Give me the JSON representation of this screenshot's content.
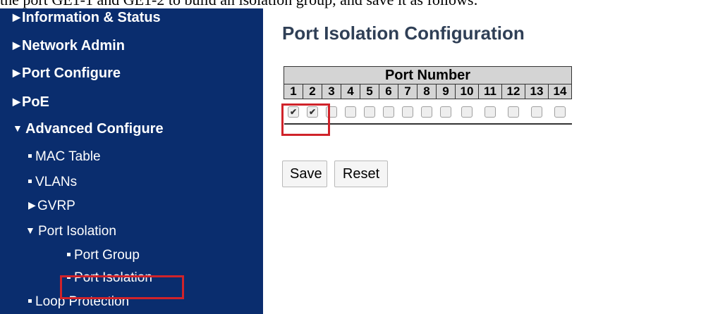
{
  "document": {
    "text_line": "the port GE1-1 and GE1-2 to build an isolation group, and save it as follows:"
  },
  "sidebar": {
    "items": [
      {
        "label": "Information & Status",
        "level": 0,
        "expanded": false
      },
      {
        "label": "Network Admin",
        "level": 0,
        "expanded": false
      },
      {
        "label": "Port Configure",
        "level": 0,
        "expanded": false
      },
      {
        "label": "PoE",
        "level": 0,
        "expanded": false
      },
      {
        "label": "Advanced Configure",
        "level": 0,
        "expanded": true
      },
      {
        "label": "MAC Table",
        "level": 1
      },
      {
        "label": "VLANs",
        "level": 1
      },
      {
        "label": "GVRP",
        "level": 1,
        "expanded": false
      },
      {
        "label": "Port Isolation",
        "level": 1,
        "expanded": true
      },
      {
        "label": "Port Group",
        "level": 2
      },
      {
        "label": "Port Isolation",
        "level": 2,
        "selected": true
      },
      {
        "label": "Loop Protection",
        "level": 1
      }
    ]
  },
  "main": {
    "title": "Port Isolation Configuration",
    "table_header": "Port Number",
    "ports": [
      "1",
      "2",
      "3",
      "4",
      "5",
      "6",
      "7",
      "8",
      "9",
      "10",
      "11",
      "12",
      "13",
      "14"
    ],
    "checked": [
      true,
      true,
      false,
      false,
      false,
      false,
      false,
      false,
      false,
      false,
      false,
      false,
      false,
      false
    ],
    "save_label": "Save",
    "reset_label": "Reset"
  },
  "colors": {
    "sidebar_bg": "#0a2d6e",
    "highlight": "#d0232a",
    "title": "#2f3f56",
    "table_header_bg": "#d4d4d4"
  }
}
